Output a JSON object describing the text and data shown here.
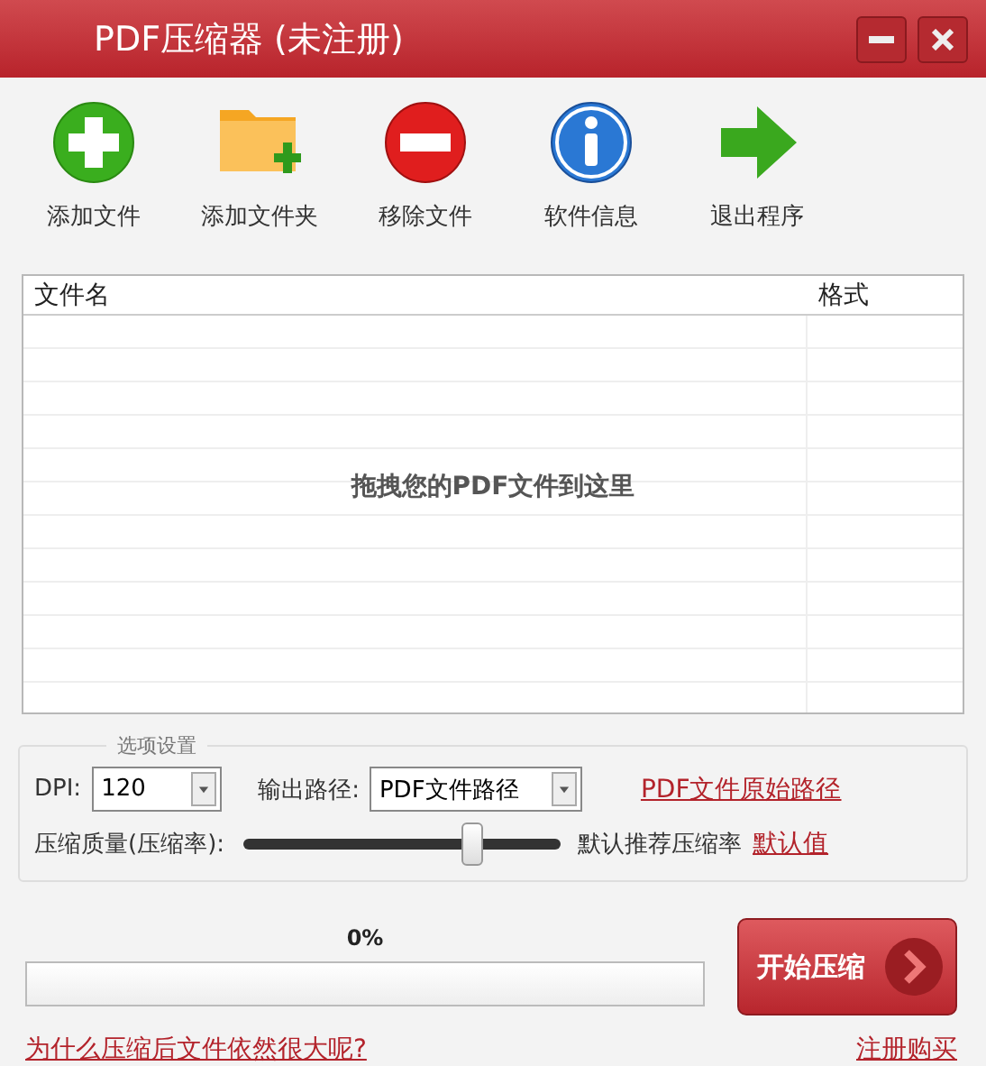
{
  "window": {
    "title": "PDF压缩器 (未注册)"
  },
  "toolbar": [
    {
      "kind": "add-file",
      "label": "添加文件"
    },
    {
      "kind": "add-folder",
      "label": "添加文件夹"
    },
    {
      "kind": "remove",
      "label": "移除文件"
    },
    {
      "kind": "info",
      "label": "软件信息"
    },
    {
      "kind": "exit",
      "label": "退出程序"
    }
  ],
  "table": {
    "columns": [
      "文件名",
      "格式"
    ],
    "empty_text": "拖拽您的PDF文件到这里"
  },
  "options": {
    "legend": "选项设置",
    "dpi_label": "DPI:",
    "dpi_value": "120",
    "output_label": "输出路径:",
    "output_value": "PDF文件路径",
    "original_path_link": "PDF文件原始路径",
    "quality_label": "压缩质量(压缩率):",
    "quality": {
      "level": 0.73
    },
    "quality_text": "默认推荐压缩率",
    "default_link": "默认值"
  },
  "progress": {
    "reading": "0%",
    "level": 0
  },
  "start_button": "开始压缩",
  "help_link": "为什么压缩后文件依然很大呢?",
  "register_link": "注册购买"
}
